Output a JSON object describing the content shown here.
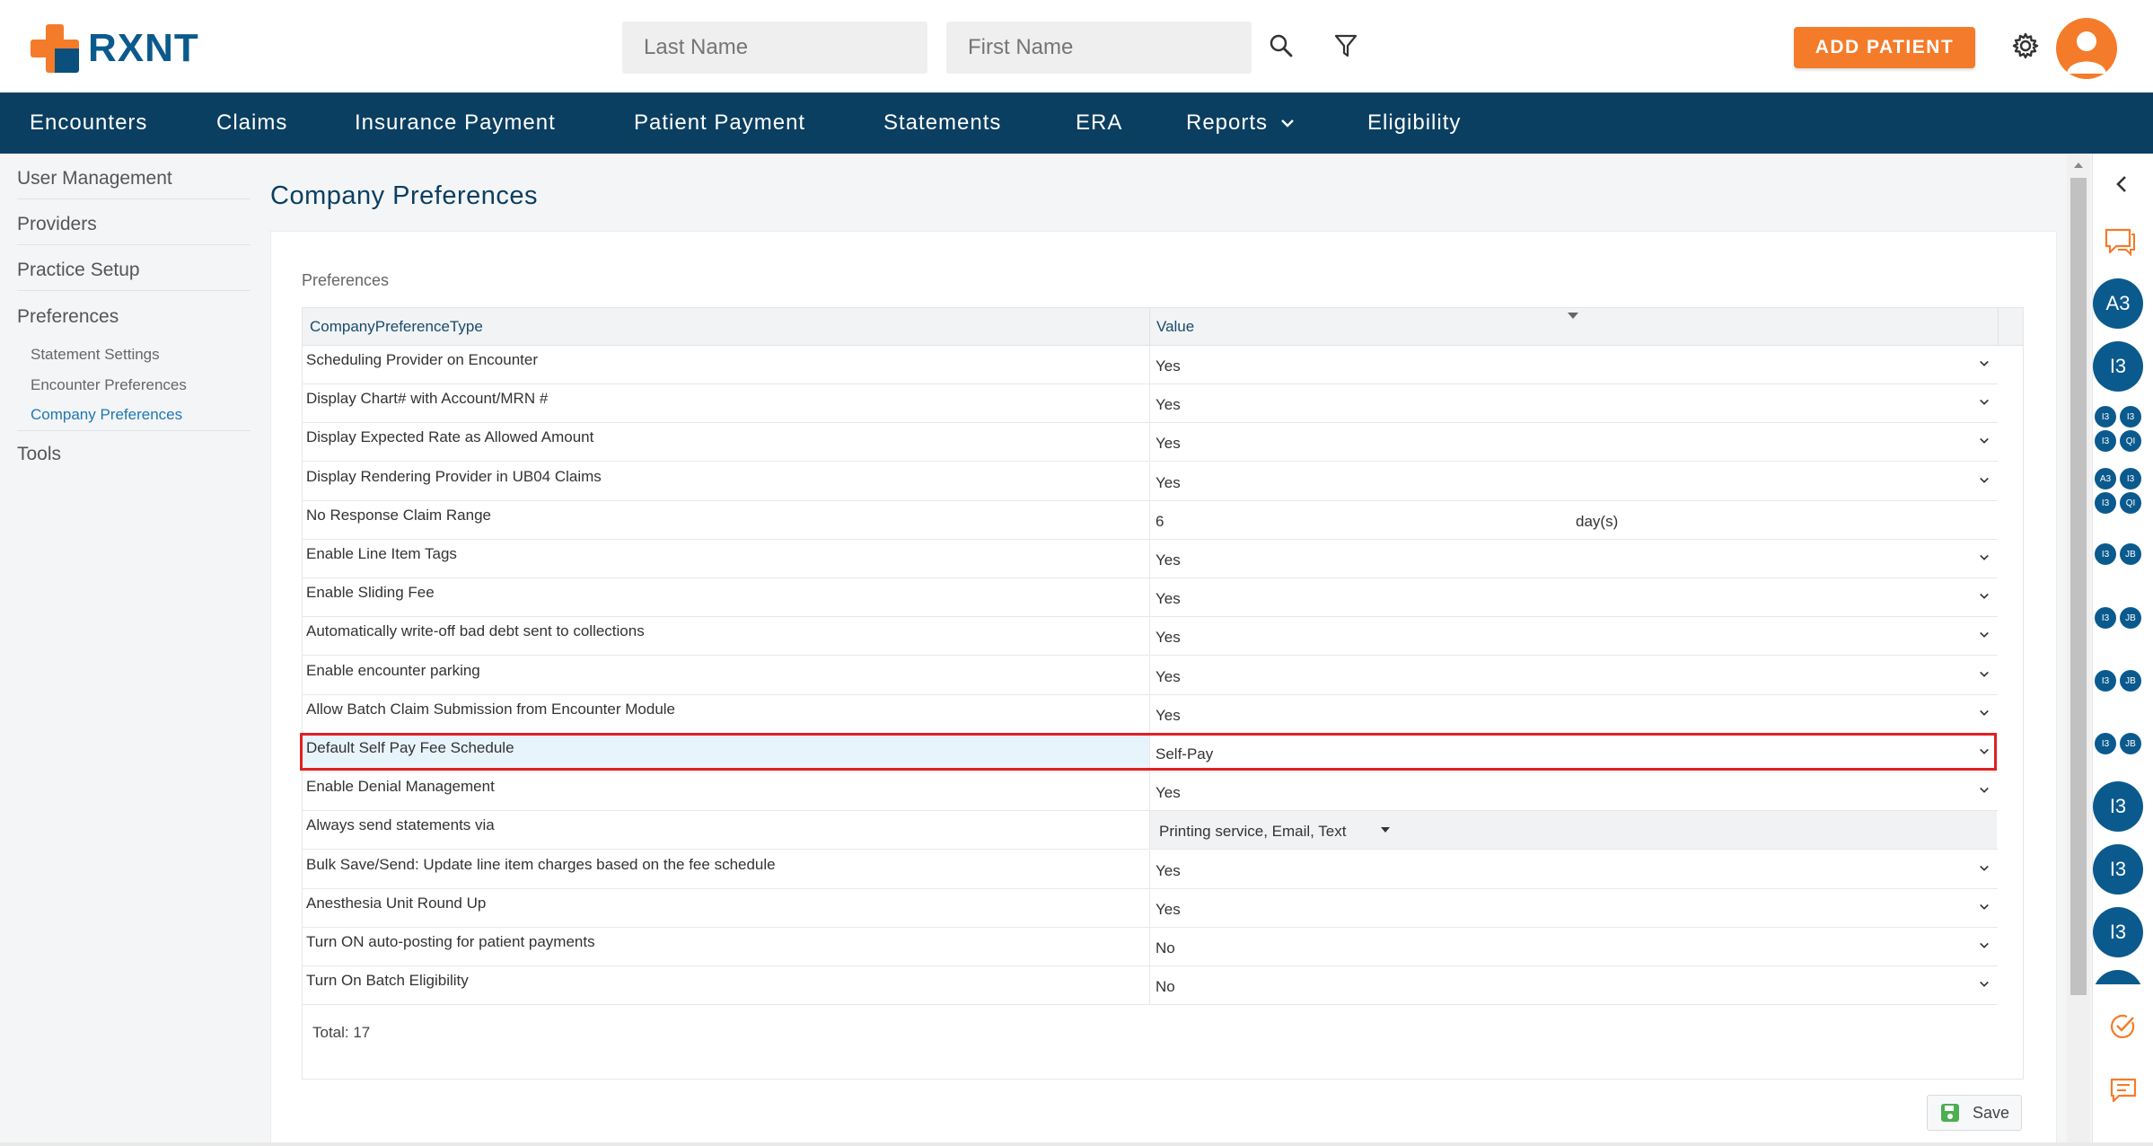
{
  "brand": {
    "name": "RXNT"
  },
  "header": {
    "last_name_placeholder": "Last Name",
    "first_name_placeholder": "First Name",
    "add_patient_label": "ADD PATIENT"
  },
  "nav": {
    "items": [
      "Encounters",
      "Claims",
      "Insurance Payment",
      "Patient Payment",
      "Statements",
      "ERA",
      "Reports",
      "Eligibility"
    ]
  },
  "sidebar": {
    "items": [
      "User Management",
      "Providers",
      "Practice Setup",
      "Preferences",
      "Tools"
    ],
    "sub_items": [
      "Statement Settings",
      "Encounter Preferences",
      "Company Preferences"
    ]
  },
  "page": {
    "title": "Company Preferences",
    "section_label": "Preferences"
  },
  "table": {
    "columns": [
      "CompanyPreferenceType",
      "Value"
    ],
    "rows": [
      {
        "name": "Scheduling Provider on Encounter",
        "value": "Yes"
      },
      {
        "name": "Display Chart# with Account/MRN #",
        "value": "Yes"
      },
      {
        "name": "Display Expected Rate as Allowed Amount",
        "value": "Yes"
      },
      {
        "name": "Display Rendering Provider in UB04 Claims",
        "value": "Yes"
      },
      {
        "name": "No Response Claim Range",
        "value": "6",
        "unit": "day(s)"
      },
      {
        "name": "Enable Line Item Tags",
        "value": "Yes"
      },
      {
        "name": "Enable Sliding Fee",
        "value": "Yes"
      },
      {
        "name": "Automatically write-off bad debt sent to collections",
        "value": "Yes"
      },
      {
        "name": "Enable encounter parking",
        "value": "Yes"
      },
      {
        "name": "Allow Batch Claim Submission from Encounter Module",
        "value": "Yes"
      },
      {
        "name": "Default Self Pay Fee Schedule",
        "value": "Self-Pay"
      },
      {
        "name": "Enable Denial Management",
        "value": "Yes"
      },
      {
        "name": "Always send statements via",
        "value": "Printing service,  Email,  Text"
      },
      {
        "name": "Bulk Save/Send: Update line item charges based on the fee schedule",
        "value": "Yes"
      },
      {
        "name": "Anesthesia Unit Round Up",
        "value": "Yes"
      },
      {
        "name": "Turn ON auto-posting for patient payments",
        "value": "No"
      },
      {
        "name": "Turn On Batch Eligibility",
        "value": "No"
      }
    ],
    "total": "Total: 17"
  },
  "actions": {
    "save_label": "Save"
  },
  "rail": {
    "avatars": [
      "A3",
      "I3",
      "I3",
      "I3",
      "I3"
    ],
    "small_avatars": [
      "I3",
      "I3",
      "I3",
      "QI",
      "A3",
      "I3",
      "I3",
      "QI",
      "I3",
      "JB",
      "I3",
      "JB",
      "I3",
      "JB",
      "I3",
      "JB"
    ]
  },
  "colors": {
    "brand_orange": "#f47b2a",
    "nav_blue": "#0b3f61",
    "accent_blue": "#0b5a8e",
    "highlight_red": "#e02020"
  }
}
